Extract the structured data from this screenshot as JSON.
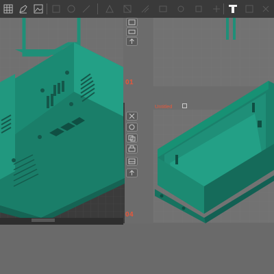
{
  "app": {
    "toolbar_tools": [
      {
        "id": "grid",
        "icon": "grid-icon"
      },
      {
        "id": "sketch",
        "icon": "pen-icon"
      },
      {
        "id": "image",
        "icon": "image-icon"
      },
      {
        "id": "t4",
        "icon": "toolbar-icon"
      },
      {
        "id": "t5",
        "icon": "toolbar-icon"
      },
      {
        "id": "t6",
        "icon": "toolbar-icon"
      },
      {
        "id": "t7",
        "icon": "toolbar-icon"
      },
      {
        "id": "t8",
        "icon": "toolbar-icon"
      },
      {
        "id": "t9",
        "icon": "toolbar-icon"
      },
      {
        "id": "t10",
        "icon": "toolbar-icon"
      },
      {
        "id": "t11",
        "icon": "toolbar-icon"
      },
      {
        "id": "t12",
        "icon": "toolbar-icon"
      },
      {
        "id": "text",
        "icon": "text-tool-icon"
      },
      {
        "id": "t14",
        "icon": "toolbar-icon"
      }
    ]
  },
  "panels": {
    "p1_label": "01",
    "p4_label": "04"
  },
  "doc": {
    "title": "Untitled"
  },
  "colors": {
    "model": "#1f8f78",
    "model_dark": "#156454",
    "accent": "#e8573a"
  },
  "view_buttons": [
    "box-view-icon",
    "frame-view-icon",
    "up-arrow-icon",
    "close-icon",
    "rotate-icon",
    "copy-icon",
    "print-icon",
    "export-icon",
    "up-arrow-icon"
  ]
}
